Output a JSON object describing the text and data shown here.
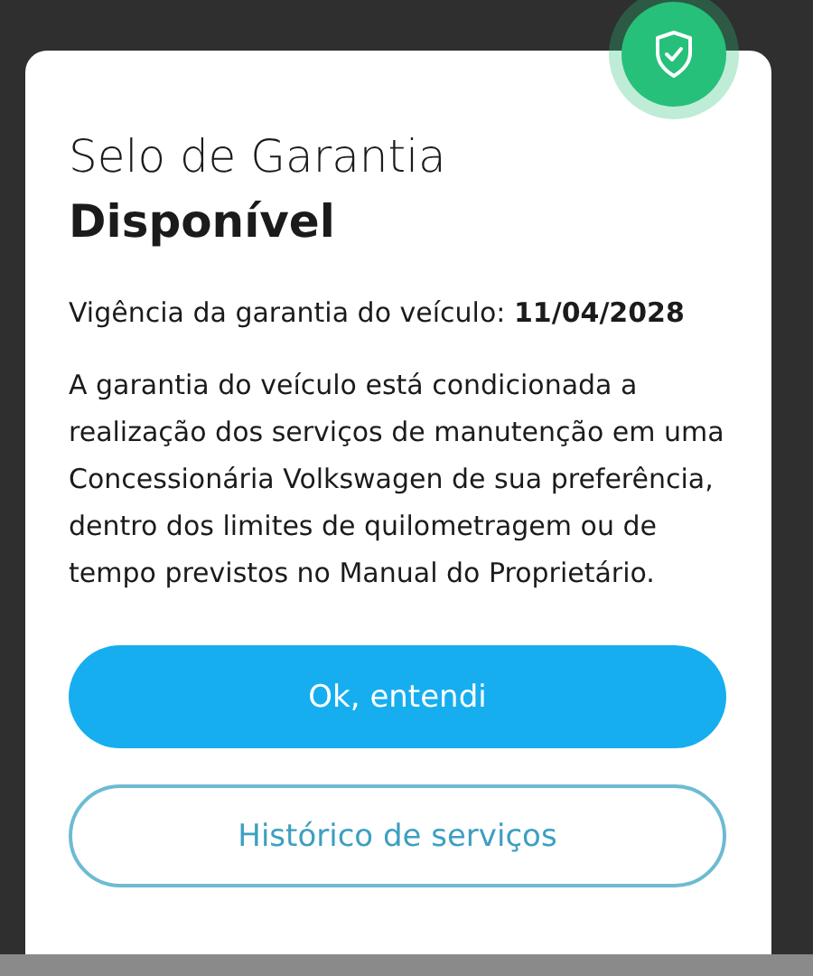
{
  "dialog": {
    "title": "Selo de Garantia",
    "status": "Disponível",
    "validity": "Vigência da garantia do veículo: **11/04/2028**",
    "description": "A garantia do veículo está condicionada a realização dos serviços de manutenção em uma Concessionária Volkswagen de sua preferência, dentro dos limites de quilometragem ou de tempo previstos no Manual do Proprietário.",
    "buttons": [
      {
        "label": "Ok, entendi",
        "kind": "primary"
      },
      {
        "label": "Histórico de serviços",
        "kind": "outline"
      }
    ]
  }
}
